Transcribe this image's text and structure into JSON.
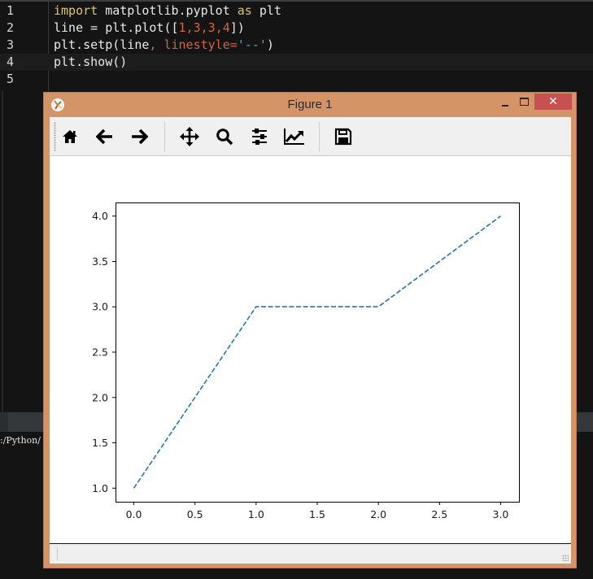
{
  "editor": {
    "lines": [
      {
        "number": "1",
        "tokens": [
          {
            "t": "import",
            "c": "kw"
          },
          {
            "t": " matplotlib.pyplot ",
            "c": ""
          },
          {
            "t": "as",
            "c": "kw"
          },
          {
            "t": " plt",
            "c": ""
          }
        ]
      },
      {
        "number": "2",
        "tokens": [
          {
            "t": "line = plt.plot([",
            "c": ""
          },
          {
            "t": "1",
            "c": "num"
          },
          {
            "t": ",",
            "c": "punct"
          },
          {
            "t": "3",
            "c": "num"
          },
          {
            "t": ",",
            "c": "punct"
          },
          {
            "t": "3",
            "c": "num"
          },
          {
            "t": ",",
            "c": "punct"
          },
          {
            "t": "4",
            "c": "num"
          },
          {
            "t": "])",
            "c": ""
          }
        ]
      },
      {
        "number": "3",
        "tokens": [
          {
            "t": "plt.setp(line",
            "c": ""
          },
          {
            "t": ", linestyle=",
            "c": "kwarg"
          },
          {
            "t": "'--'",
            "c": "str"
          },
          {
            "t": ")",
            "c": ""
          }
        ]
      },
      {
        "number": "4",
        "tokens": [
          {
            "t": "plt.show()",
            "c": ""
          }
        ]
      },
      {
        "number": "5",
        "tokens": []
      }
    ],
    "current_line": 4
  },
  "console": {
    "text": ":/Python/"
  },
  "window": {
    "title": "Figure 1",
    "close_glyph": "✕",
    "toolbar": [
      {
        "name": "home",
        "tooltip": "Reset original view",
        "icon": "home-icon"
      },
      {
        "name": "back",
        "tooltip": "Back to previous view",
        "icon": "arrow-left-icon"
      },
      {
        "name": "forward",
        "tooltip": "Forward to next view",
        "icon": "arrow-right-icon"
      },
      {
        "name": "pan",
        "tooltip": "Pan axes",
        "icon": "move-icon"
      },
      {
        "name": "zoom",
        "tooltip": "Zoom to rectangle",
        "icon": "magnifier-icon"
      },
      {
        "name": "subplots",
        "tooltip": "Configure subplots",
        "icon": "sliders-icon"
      },
      {
        "name": "customize",
        "tooltip": "Edit axis, curve and image parameters",
        "icon": "chart-line-icon"
      },
      {
        "name": "save",
        "tooltip": "Save the figure",
        "icon": "floppy-disk-icon"
      }
    ]
  },
  "chart_data": {
    "type": "line",
    "title": "",
    "xlabel": "",
    "ylabel": "",
    "x": [
      0,
      1,
      2,
      3
    ],
    "series": [
      {
        "name": "line",
        "values": [
          1,
          3,
          3,
          4
        ],
        "color": "#1f77b4",
        "linestyle": "--"
      }
    ],
    "xlim": [
      -0.15,
      3.15
    ],
    "ylim": [
      0.85,
      4.15
    ],
    "xticks": [
      0.0,
      0.5,
      1.0,
      1.5,
      2.0,
      2.5,
      3.0
    ],
    "xtick_labels": [
      "0.0",
      "0.5",
      "1.0",
      "1.5",
      "2.0",
      "2.5",
      "3.0"
    ],
    "yticks": [
      1.0,
      1.5,
      2.0,
      2.5,
      3.0,
      3.5,
      4.0
    ],
    "ytick_labels": [
      "1.0",
      "1.5",
      "2.0",
      "2.5",
      "3.0",
      "3.5",
      "4.0"
    ],
    "grid": false,
    "legend": "none"
  }
}
